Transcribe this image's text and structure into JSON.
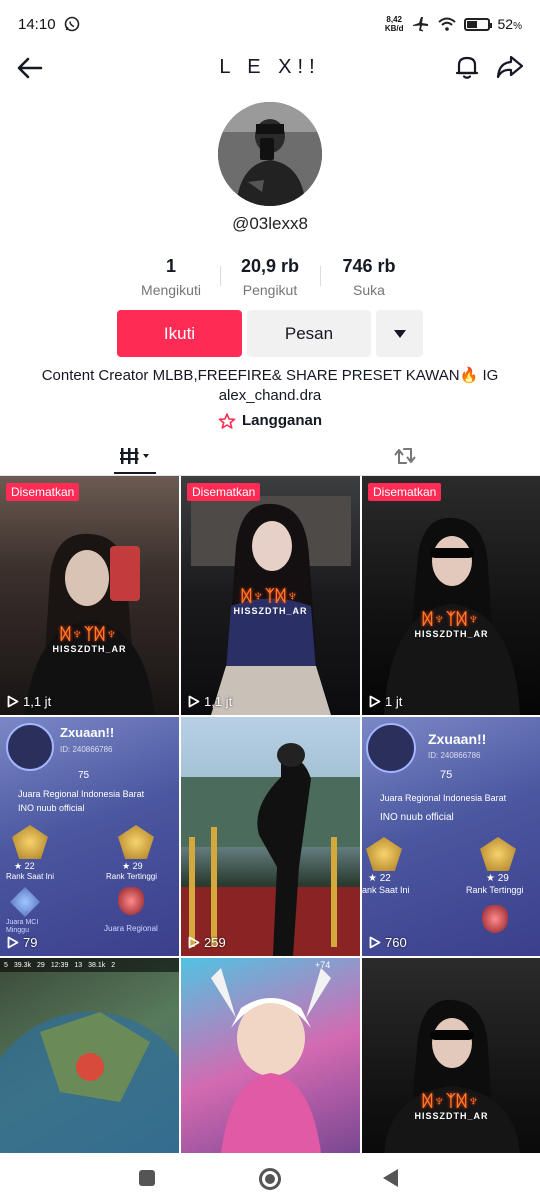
{
  "status_bar": {
    "time": "14:10",
    "net_speed_value": "8,42",
    "net_speed_unit": "KB/d",
    "battery": "52",
    "battery_unit": "%",
    "battery_level": 0.52,
    "icons": [
      "whatsapp-icon",
      "airplane-icon",
      "wifi-icon",
      "battery-icon"
    ]
  },
  "header": {
    "title": "L E X!!",
    "icons": [
      "back-arrow-icon",
      "bell-icon",
      "share-icon"
    ]
  },
  "profile": {
    "username": "@03lexx8",
    "stats": [
      {
        "value": "1",
        "label": "Mengikuti"
      },
      {
        "value": "20,9 rb",
        "label": "Pengikut"
      },
      {
        "value": "746 rb",
        "label": "Suka"
      }
    ],
    "buttons": {
      "follow": "Ikuti",
      "message": "Pesan"
    },
    "bio_line1": "Content Creator MLBB,FREEFIRE& SHARE PRESET KAWAN🔥 IG",
    "bio_line2": "alex_chand.dra",
    "subscription_label": "Langganan"
  },
  "tabs": [
    "videos-grid-icon",
    "repost-icon"
  ],
  "grid": {
    "pinned_label": "Disematkan",
    "logo_caption": "HISSZDTH_AR",
    "videos": [
      {
        "views": "1,1 jt",
        "pinned": true
      },
      {
        "views": "1,1 jt",
        "pinned": true
      },
      {
        "views": "1 jt",
        "pinned": true
      },
      {
        "views": "79",
        "pinned": false,
        "overlay": [
          "Zxuaan!!",
          "ID: 240866786",
          "75",
          "Juara Regional Indonesia Barat",
          "INO nuub official",
          "22",
          "Rank Saat Ini",
          "29",
          "Rank Tertinggi",
          "Juara MCI",
          "Minggu",
          "Juara Regional"
        ]
      },
      {
        "views": "259",
        "pinned": false
      },
      {
        "views": "760",
        "pinned": false,
        "overlay": [
          "Zxuaan!!",
          "ID: 240866786",
          "75",
          "Juara Regional Indonesia Barat",
          "INO nuub official",
          "22",
          "ank Saat Ini",
          "29",
          "Rank Tertinggi"
        ]
      },
      {
        "views": "",
        "pinned": false,
        "overlay": [
          "5",
          "39.3k",
          "29",
          "12:39",
          "13",
          "38.1k",
          "2"
        ]
      },
      {
        "views": "",
        "pinned": false,
        "overlay": [
          "74"
        ]
      },
      {
        "views": "",
        "pinned": false
      }
    ]
  },
  "nav": [
    "recents-button",
    "home-button",
    "back-button"
  ]
}
